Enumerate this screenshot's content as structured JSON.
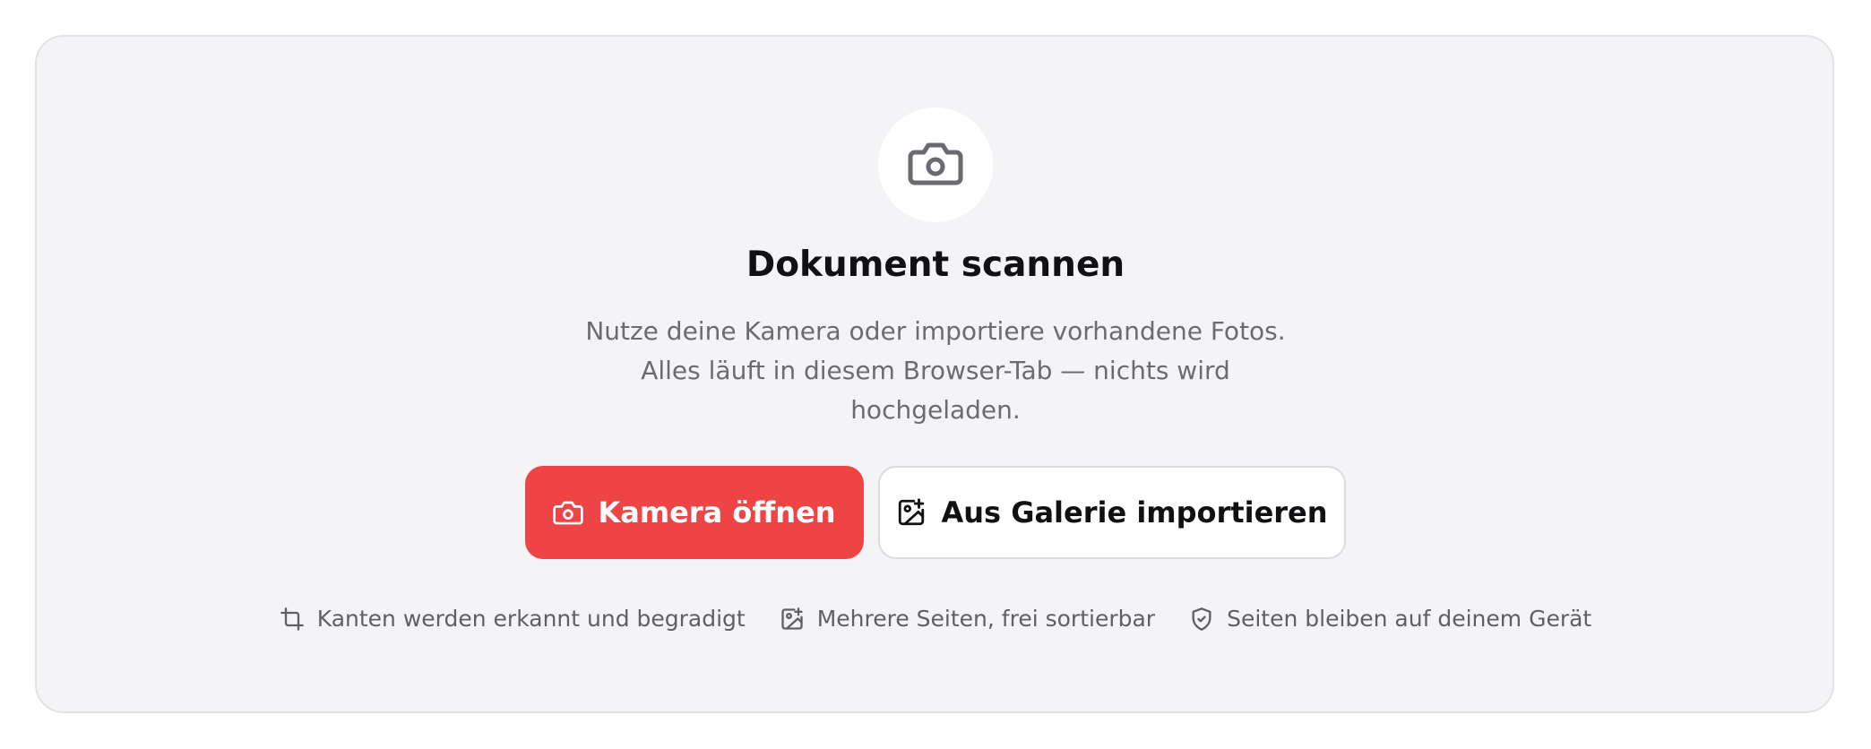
{
  "hero": {
    "icon": "camera-icon",
    "title": "Dokument scannen",
    "description_lines": [
      "Nutze deine Kamera oder importiere vorhandene Fotos.",
      "Alles läuft in diesem Browser-Tab — nichts wird",
      "hochgeladen."
    ]
  },
  "actions": {
    "camera": {
      "label": "Kamera öffnen",
      "icon": "camera-icon",
      "color": "#ef4446"
    },
    "gallery": {
      "label": "Aus Galerie importieren",
      "icon": "image-plus-icon"
    }
  },
  "features": [
    {
      "icon": "crop-icon",
      "label": "Kanten werden erkannt und begradigt"
    },
    {
      "icon": "image-plus-icon",
      "label": "Mehrere Seiten, frei sortierbar"
    },
    {
      "icon": "shield-check-icon",
      "label": "Seiten bleiben auf deinem Gerät"
    }
  ]
}
